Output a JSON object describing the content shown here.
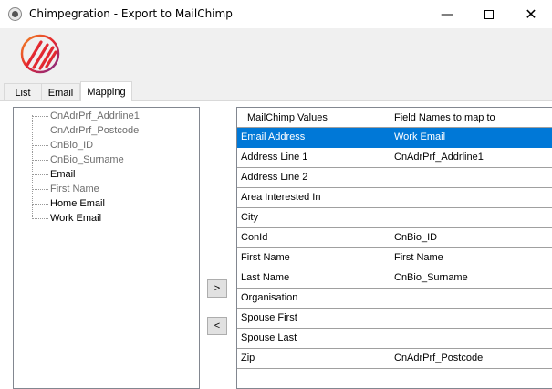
{
  "window": {
    "title": "Chimpegration - Export to MailChimp",
    "minimize_glyph": "—",
    "close_glyph": "✕"
  },
  "tabs": [
    {
      "label": "List",
      "active": false
    },
    {
      "label": "Email",
      "active": false
    },
    {
      "label": "Mapping",
      "active": true
    }
  ],
  "tree": {
    "items": [
      {
        "label": "CnAdrPrf_Addrline1",
        "style": "grey"
      },
      {
        "label": "CnAdrPrf_Postcode",
        "style": "grey"
      },
      {
        "label": "CnBio_ID",
        "style": "grey"
      },
      {
        "label": "CnBio_Surname",
        "style": "grey"
      },
      {
        "label": "Email",
        "style": "black"
      },
      {
        "label": "First Name",
        "style": "grey"
      },
      {
        "label": "Home Email",
        "style": "black"
      },
      {
        "label": "Work Email",
        "style": "black"
      }
    ]
  },
  "buttons": {
    "add_label": ">",
    "remove_label": "<"
  },
  "grid": {
    "columns": [
      "MailChimp Values",
      "Field Names to map to"
    ],
    "selected_row": 0,
    "rows": [
      {
        "mailchimp": "Email Address",
        "field": "Work Email"
      },
      {
        "mailchimp": "Address Line 1",
        "field": "CnAdrPrf_Addrline1"
      },
      {
        "mailchimp": "Address Line 2",
        "field": ""
      },
      {
        "mailchimp": "Area Interested In",
        "field": ""
      },
      {
        "mailchimp": "City",
        "field": ""
      },
      {
        "mailchimp": "ConId",
        "field": "CnBio_ID"
      },
      {
        "mailchimp": "First Name",
        "field": "First Name"
      },
      {
        "mailchimp": "Last Name",
        "field": "CnBio_Surname"
      },
      {
        "mailchimp": "Organisation",
        "field": ""
      },
      {
        "mailchimp": "Spouse First",
        "field": ""
      },
      {
        "mailchimp": "Spouse Last",
        "field": ""
      },
      {
        "mailchimp": "Zip",
        "field": "CnAdrPrf_Postcode"
      }
    ]
  },
  "colors": {
    "selection": "#0078d7",
    "logo_red": "#e5262f",
    "logo_orange": "#f08a24",
    "logo_purple": "#7a2b8e"
  },
  "icons": {
    "app": "chimp-app-icon",
    "logo": "chimpegration-logo"
  }
}
